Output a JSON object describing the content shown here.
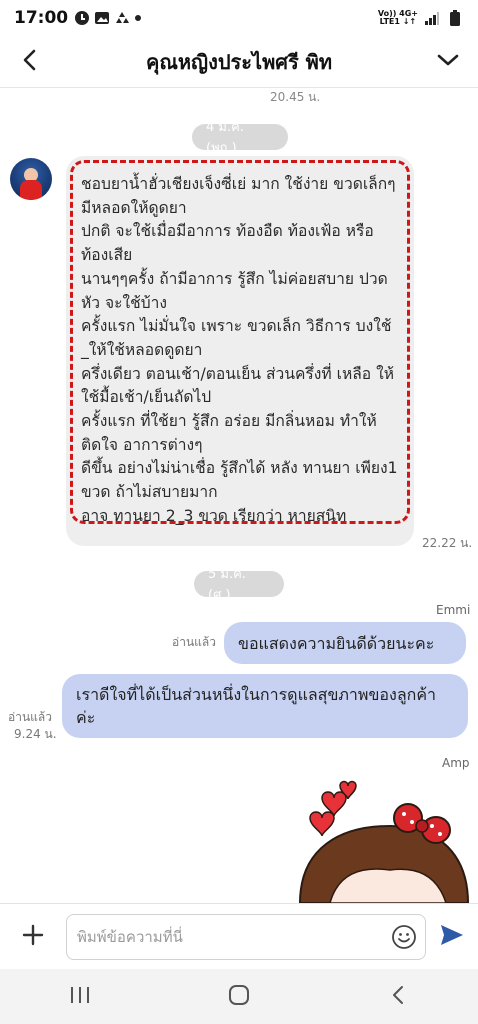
{
  "status_bar": {
    "time": "17:00",
    "network_top": "Vo)) 4G+",
    "network_bottom": "LTE1 ↓↑",
    "icons": [
      "line-app-icon",
      "gallery-icon",
      "recycle-icon",
      "dot-icon",
      "signal-icon",
      "battery-icon"
    ]
  },
  "header": {
    "title": "คุณหญิงประไพศรี  พิท",
    "back_icon": "chevron-left-icon",
    "menu_icon": "chevron-down-icon"
  },
  "chat": {
    "prev_time": "20.45 น.",
    "date1": "4 ม.ค. (พฤ.)",
    "long_message": "ชอบยาน้ำฮั่วเชียงเจ็งซี่เย่ มาก ใช้ง่าย ขวดเล็กๆ มีหลอดให้ดูดยา\nปกติ จะใช้เมื่อมีอาการ ท้องอืด ท้องเฟ้อ หรือ  ท้องเสีย\nนานๆๆครั้ง ถ้ามีอาการ รู้สึก ไม่ค่อยสบาย ปวดหัว จะใช้บ้าง\nครั้งแรก ไม่มั่นใจ เพราะ ขวดเล็ก   วิธีการ บงใช้ _ให้ใช้หลอดดูดยา\nครึ่งเดียว  ตอนเช้า/ตอนเย็น ส่วนครึ่งที่ เหลือ ให้ใช้มื้อเช้า/เย็นถัดไป\nครั้งแรก ที่ใช้ยา  รู้สึก อร่อย มีกลิ่นหอม ทำให้ติดใจ  อาการต่างๆ\nดีขึ้น อย่างไม่น่าเชื่อ  รู้สึกได้  หลัง ทานยา เพียง1 ขวด   ถ้าไม่สบายมาก\nอาจ ทานยา 2_3 ขวด  เรียกว่า หายสนิท",
    "long_message_time": "22.22 น.",
    "date2": "5 ม.ค. (ศ.)",
    "sender1": "Emmi",
    "read_label1": "อ่านแล้ว",
    "outgoing1": "ขอแสดงความยินดีด้วยนะคะ",
    "read_label2": "อ่านแล้ว",
    "outgoing2_time": "9.24 น.",
    "outgoing2": "เราดีใจที่ได้เป็นส่วนหนึ่งในการดูแลสุขภาพของลูกค้าค่ะ",
    "sender2": "Amp"
  },
  "input": {
    "placeholder": "พิมพ์ข้อความที่นี่",
    "add_icon": "plus-icon",
    "emoji_icon": "smiley-icon",
    "send_icon": "send-icon"
  },
  "nav": {
    "icons": [
      "recent-apps-icon",
      "home-icon",
      "back-icon"
    ]
  },
  "colors": {
    "outgoing_bubble": "#c7d2f3",
    "incoming_bubble": "#eeeeee",
    "highlight_dash": "#d01717",
    "date_chip": "#d9d9d9",
    "send": "#2e5aa8"
  }
}
